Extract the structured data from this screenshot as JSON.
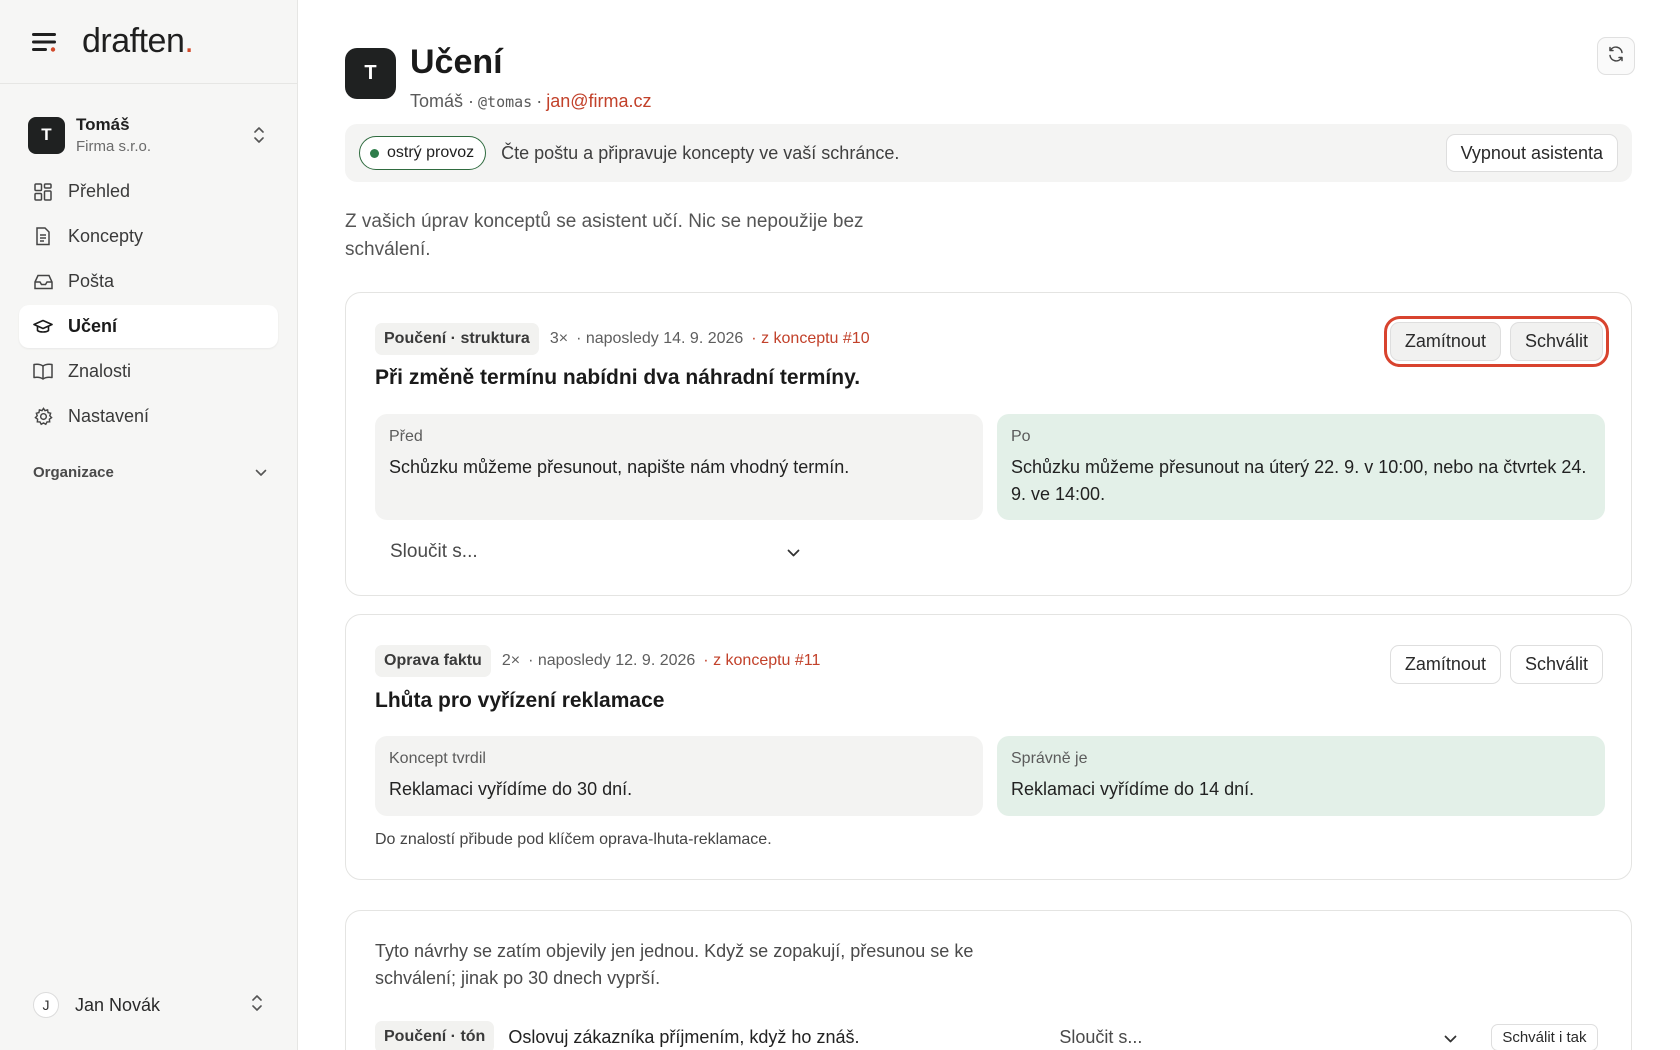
{
  "brand": {
    "name": "draften",
    "dot": "."
  },
  "workspace": {
    "initial": "T",
    "name": "Tomáš",
    "org": "Firma s.r.o."
  },
  "nav": [
    {
      "label": "Přehled",
      "icon": "dashboard-icon",
      "active": false
    },
    {
      "label": "Koncepty",
      "icon": "document-icon",
      "active": false
    },
    {
      "label": "Pošta",
      "icon": "inbox-icon",
      "active": false
    },
    {
      "label": "Učení",
      "icon": "graduation-cap-icon",
      "active": true
    },
    {
      "label": "Znalosti",
      "icon": "book-icon",
      "active": false
    },
    {
      "label": "Nastavení",
      "icon": "gear-icon",
      "active": false
    }
  ],
  "org_section": {
    "label": "Organizace"
  },
  "user": {
    "initial": "J",
    "name": "Jan Novák"
  },
  "header": {
    "initial": "T",
    "title": "Učení",
    "name": "Tomáš",
    "sep": "·",
    "handle": "@tomas",
    "email": "jan@firma.cz"
  },
  "status": {
    "pill": "ostrý provoz",
    "text": "Čte poštu a připravuje koncepty ve vaší schránce.",
    "button": "Vypnout asistenta"
  },
  "intro": "Z vašich úprav konceptů se asistent učí. Nic se nepoužije bez schválení.",
  "cards": [
    {
      "tag": "Poučení · struktura",
      "count": "3×",
      "date": "· naposledy 14. 9. 2026",
      "link": "· z konceptu #10",
      "title": "Při změně termínu nabídni dva náhradní termíny.",
      "reject": "Zamítnout",
      "approve": "Schválit",
      "left_label": "Před",
      "left_text": "Schůzku můžeme přesunout, napište nám vhodný termín.",
      "right_label": "Po",
      "right_text": "Schůzku můžeme přesunout na úterý 22. 9. v 10:00, nebo na čtvrtek 24. 9. ve 14:00.",
      "merge": "Sloučit s..."
    },
    {
      "tag": "Oprava faktu",
      "count": "2×",
      "date": "· naposledy 12. 9. 2026",
      "link": "· z konceptu #11",
      "title": "Lhůta pro vyřízení reklamace",
      "reject": "Zamítnout",
      "approve": "Schválit",
      "left_label": "Koncept tvrdil",
      "left_text": "Reklamaci vyřídíme do 30 dní.",
      "right_label": "Správně je",
      "right_text": "Reklamaci vyřídíme do 14 dní.",
      "note": "Do znalostí přibude pod klíčem oprava-lhuta-reklamace."
    }
  ],
  "pending": {
    "text": "Tyto návrhy se zatím objevily jen jednou. Když se zopakují, přesunou se ke schválení; jinak po 30 dnech vyprší.",
    "tag": "Poučení · tón",
    "rule": "Oslovuj zákazníka příjmením, když ho znáš.",
    "merge": "Sloučit s...",
    "button": "Schválit i tak"
  }
}
